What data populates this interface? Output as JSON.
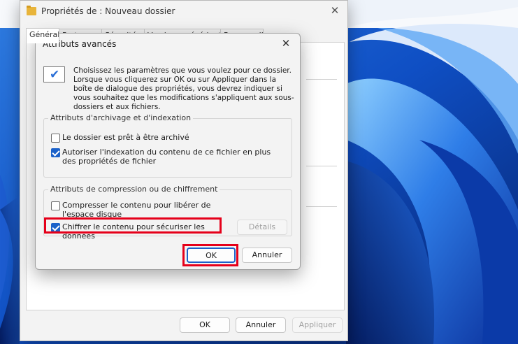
{
  "properties_window": {
    "title": "Propriétés de : Nouveau dossier",
    "tabs": [
      "Général",
      "Partage",
      "Sécurité",
      "Versions précédentes",
      "Personnaliser"
    ],
    "ok_label": "OK",
    "cancel_label": "Annuler",
    "apply_label": "Appliquer"
  },
  "advanced_dialog": {
    "title": "Attributs avancés",
    "info_text": "Choisissez les paramètres que vous voulez pour ce dossier. Lorsque vous cliquerez sur OK ou sur Appliquer dans la boîte de dialogue des propriétés, vous devrez indiquer si vous souhaitez que les modifications s'appliquent aux sous-dossiers et aux fichiers.",
    "archive_group": {
      "legend": "Attributs d'archivage et d'indexation",
      "archive_label": "Le dossier est prêt à être archivé",
      "archive_checked": false,
      "index_label": "Autoriser l'indexation du contenu de ce fichier en plus des propriétés de fichier",
      "index_checked": true
    },
    "compress_group": {
      "legend": "Attributs de compression ou de chiffrement",
      "compress_label": "Compresser le contenu pour libérer de l'espace disque",
      "compress_checked": false,
      "encrypt_label": "Chiffrer le contenu pour sécuriser les données",
      "encrypt_checked": true,
      "details_label": "Détails"
    },
    "ok_label": "OK",
    "cancel_label": "Annuler"
  },
  "colors": {
    "highlight": "#e5001a",
    "accent": "#1b61c9"
  }
}
